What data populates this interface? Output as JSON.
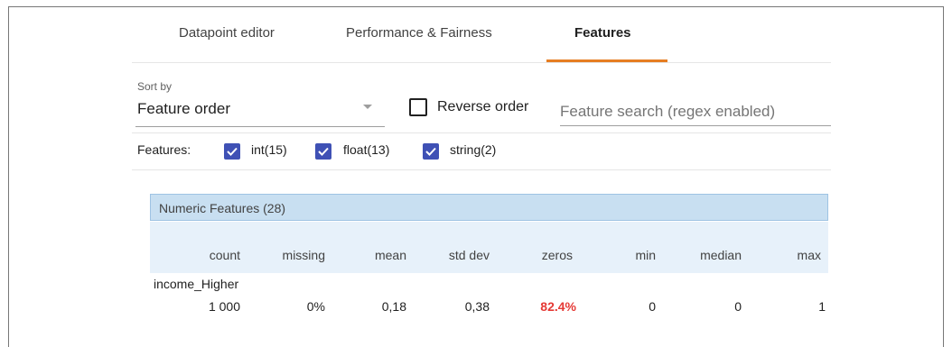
{
  "tabs": [
    {
      "label": "Datapoint editor"
    },
    {
      "label": "Performance & Fairness"
    },
    {
      "label": "Features"
    }
  ],
  "active_tab": "Features",
  "sort": {
    "label": "Sort by",
    "value": "Feature order"
  },
  "reverse_order": {
    "label": "Reverse order",
    "checked": false
  },
  "search": {
    "placeholder": "Feature search (regex enabled)",
    "value": ""
  },
  "filters": {
    "label": "Features:",
    "items": [
      {
        "label": "int(15)",
        "checked": true
      },
      {
        "label": "float(13)",
        "checked": true
      },
      {
        "label": "string(2)",
        "checked": true
      }
    ]
  },
  "numeric_table": {
    "title": "Numeric Features (28)",
    "columns": [
      "count",
      "missing",
      "mean",
      "std dev",
      "zeros",
      "min",
      "median",
      "max"
    ],
    "rows": [
      {
        "feature": "income_Higher",
        "count": "1 000",
        "missing": "0%",
        "mean": "0,18",
        "std_dev": "0,38",
        "zeros": "82.4%",
        "min": "0",
        "median": "0",
        "max": "1"
      }
    ]
  },
  "colors": {
    "accent": "#e67e22",
    "checkbox": "#3f51b5",
    "warning": "#e53935",
    "table_header": "#c8dff1"
  }
}
